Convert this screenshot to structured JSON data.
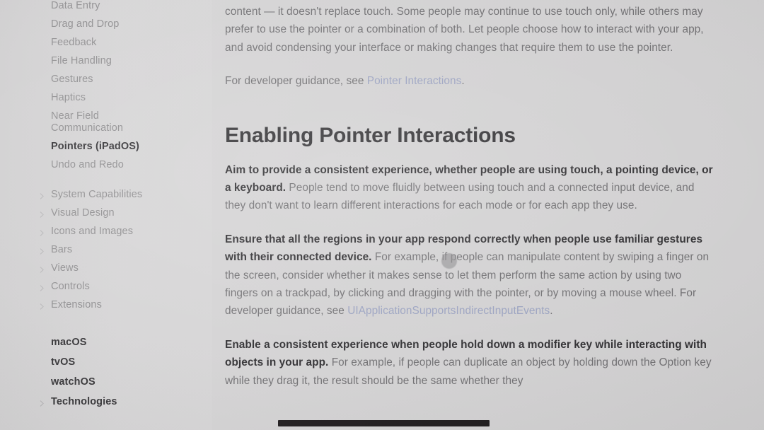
{
  "app": {
    "background_color": "#d5d4d5",
    "text_color": "#6f6e71",
    "heading_color": "#2f2e31",
    "link_color": "#9aa2c2",
    "sidebar_color": "#d3d2d3"
  },
  "sidebar": {
    "items": [
      {
        "label": "Data Entry",
        "type": "sub",
        "selected": false
      },
      {
        "label": "Drag and Drop",
        "type": "sub",
        "selected": false
      },
      {
        "label": "Feedback",
        "type": "sub",
        "selected": false
      },
      {
        "label": "File Handling",
        "type": "sub",
        "selected": false
      },
      {
        "label": "Gestures",
        "type": "sub",
        "selected": false
      },
      {
        "label": "Haptics",
        "type": "sub",
        "selected": false
      },
      {
        "label": "Near Field",
        "label2": "Communication",
        "type": "sub",
        "selected": false
      },
      {
        "label": "Pointers (iPadOS)",
        "type": "sub",
        "selected": true
      },
      {
        "label": "Undo and Redo",
        "type": "sub",
        "selected": false
      }
    ],
    "groups": [
      {
        "label": "System Capabilities",
        "icon": "chevron-right-icon"
      },
      {
        "label": "Visual Design",
        "icon": "chevron-right-icon"
      },
      {
        "label": "Icons and Images",
        "icon": "chevron-right-icon"
      },
      {
        "label": "Bars",
        "icon": "chevron-right-icon"
      },
      {
        "label": "Views",
        "icon": "chevron-right-icon"
      },
      {
        "label": "Controls",
        "icon": "chevron-right-icon"
      },
      {
        "label": "Extensions",
        "icon": "chevron-right-icon"
      }
    ],
    "platforms": [
      {
        "label": "macOS",
        "has_chevron": false
      },
      {
        "label": "tvOS",
        "has_chevron": false
      },
      {
        "label": "watchOS",
        "has_chevron": false
      },
      {
        "label": "Technologies",
        "has_chevron": true,
        "icon": "chevron-right-icon"
      }
    ]
  },
  "content": {
    "paragraph_top": {
      "text": "content — it doesn't replace touch. Some people may continue to use touch only, while others may prefer to use the pointer or a combination of both. Let people choose how to interact with your app, and avoid condensing your interface or making changes that require them to use the pointer."
    },
    "paragraph_dev_guidance": {
      "prefix": "For developer guidance, see ",
      "link": "Pointer Interactions",
      "suffix": "."
    },
    "heading": "Enabling Pointer Interactions",
    "paragraph_aim": {
      "bold": "Aim to provide a consistent experience, whether people are using touch, a pointing device, or a keyboard.",
      "rest": " People tend to move fluidly between using touch and a connected input device, and they don't want to learn different interactions for each mode or for each app they use."
    },
    "paragraph_ensure": {
      "bold": "Ensure that all the regions in your app respond correctly when people use familiar gestures with their connected device.",
      "rest": " For example, if people can manipulate content by swiping a finger on the screen, consider whether it makes sense to let them perform the same action by using two fingers on a trackpad, by clicking and dragging with the pointer, or by moving a mouse wheel. For developer guidance, see ",
      "link": "UIApplicationSupportsIndirectInputEvents",
      "suffix": "."
    },
    "paragraph_enable": {
      "bold": "Enable a consistent experience when people hold down a modifier key while interacting with objects in your app.",
      "rest": " For example, if people can duplicate an object by holding down the Option key while they drag it, the result should be the same whether they"
    }
  },
  "overlays": {
    "pointer_dot": "pointer-cursor-dot",
    "occlusion_bar": "black-occlusion-bar"
  }
}
